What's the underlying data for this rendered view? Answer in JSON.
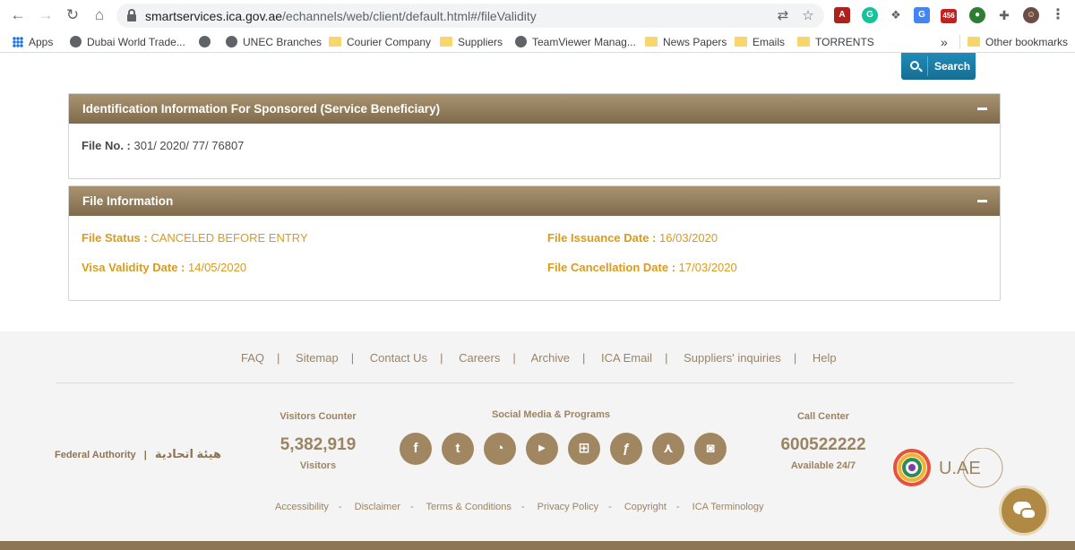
{
  "browser": {
    "url_host": "smartservices.ica.gov.ae",
    "url_path": "/echannels/web/client/default.html#/fileValidity",
    "extension_badge": "456",
    "bookmarks": [
      {
        "label": "Apps",
        "icon": "apps-icon"
      },
      {
        "label": "Dubai World Trade...",
        "icon": "globe-icon"
      },
      {
        "label": "",
        "icon": "globe-icon"
      },
      {
        "label": "UNEC Branches",
        "icon": "globe-icon"
      },
      {
        "label": "Courier Company",
        "icon": "folder-icon"
      },
      {
        "label": "Suppliers",
        "icon": "folder-icon"
      },
      {
        "label": "TeamViewer Manag...",
        "icon": "globe-icon"
      },
      {
        "label": "News Papers",
        "icon": "folder-icon"
      },
      {
        "label": "Emails",
        "icon": "folder-icon"
      },
      {
        "label": "TORRENTS",
        "icon": "folder-icon"
      }
    ],
    "overflow": "»",
    "other_bookmarks": "Other bookmarks"
  },
  "search": {
    "label": "Search"
  },
  "sponsored": {
    "title": "Identification Information For Sponsored (Service Beneficiary)",
    "file_no_label": "File No. :",
    "file_no_value": "301/ 2020/ 77/ 76807"
  },
  "file_info": {
    "title": "File Information",
    "status_label": "File Status :",
    "status_value": "CANCELED BEFORE ENTRY",
    "issuance_label": "File Issuance Date :",
    "issuance_value": "16/03/2020",
    "visa_label": "Visa Validity Date :",
    "visa_value": "14/05/2020",
    "cancel_label": "File Cancellation Date :",
    "cancel_value": "17/03/2020"
  },
  "footer": {
    "links": [
      "FAQ",
      "Sitemap",
      "Contact Us",
      "Careers",
      "Archive",
      "ICA Email",
      "Suppliers' inquiries",
      "Help"
    ],
    "federal_authority": "Federal Authority",
    "federal_authority_ar": "هيئة اتحادية",
    "visitors_title": "Visitors Counter",
    "visitors_count": "5,382,919",
    "visitors_label": "Visitors",
    "social_title": "Social Media & Programs",
    "social": [
      "facebook-icon",
      "twitter-icon",
      "rss-icon",
      "youtube-icon",
      "windows-icon",
      "flash-icon",
      "pdf-icon",
      "instagram-icon"
    ],
    "call_title": "Call Center",
    "call_number": "600522222",
    "call_available": "Available 24/7",
    "uae_text": "U.AE",
    "bottom_links": [
      "Accessibility",
      "Disclaimer",
      "Terms & Conditions",
      "Privacy Policy",
      "Copyright",
      "ICA Terminology"
    ]
  },
  "colors": {
    "panel_header": "#8c7654",
    "gold_text": "#d89b1e",
    "search_button": "#1a7ea8",
    "footer_text": "#9b8463"
  }
}
